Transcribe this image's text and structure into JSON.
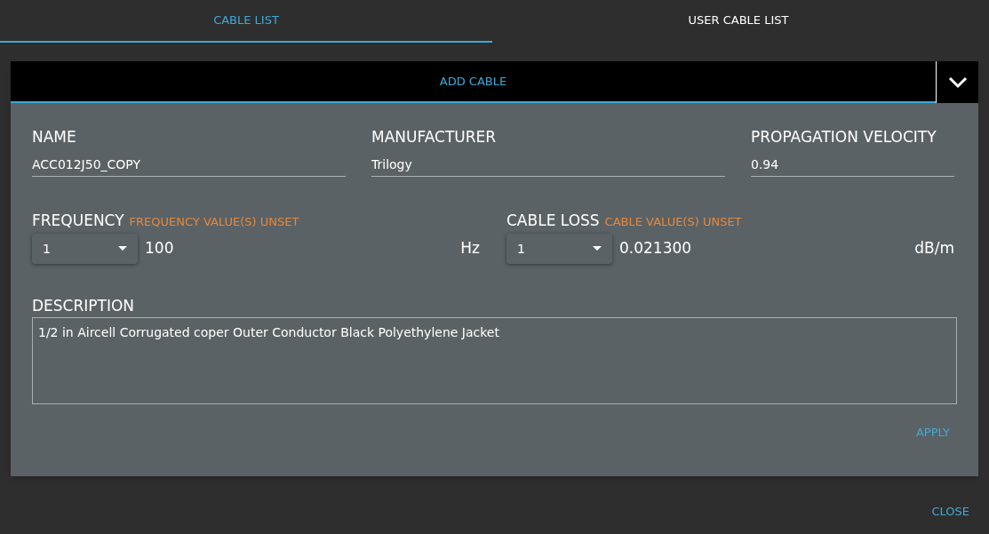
{
  "tabs": [
    {
      "label": "CABLE LIST",
      "selected": true
    },
    {
      "label": "USER CABLE LIST",
      "selected": false
    }
  ],
  "panel": {
    "title": "ADD CABLE",
    "fields": [
      {
        "label": "NAME",
        "value": "ACC012J50_COPY"
      },
      {
        "label": "MANUFACTURER",
        "value": "Trilogy"
      },
      {
        "label": "PROPAGATION VELOCITY",
        "value": "0.94"
      }
    ],
    "tables": [
      {
        "label": "FREQUENCY",
        "warning": "FREQUENCY VALUE(S) UNSET",
        "index": "1",
        "value": "100",
        "unit": "Hz"
      },
      {
        "label": "CABLE LOSS",
        "warning": "CABLE VALUE(S) UNSET",
        "index": "1",
        "value": "0.021300",
        "unit": "dB/m"
      }
    ],
    "description": {
      "label": "DESCRIPTION",
      "value": "1/2 in Aircell Corrugated coper Outer Conductor Black Polyethylene Jacket"
    },
    "apply": "APPLY"
  },
  "close": "CLOSE"
}
